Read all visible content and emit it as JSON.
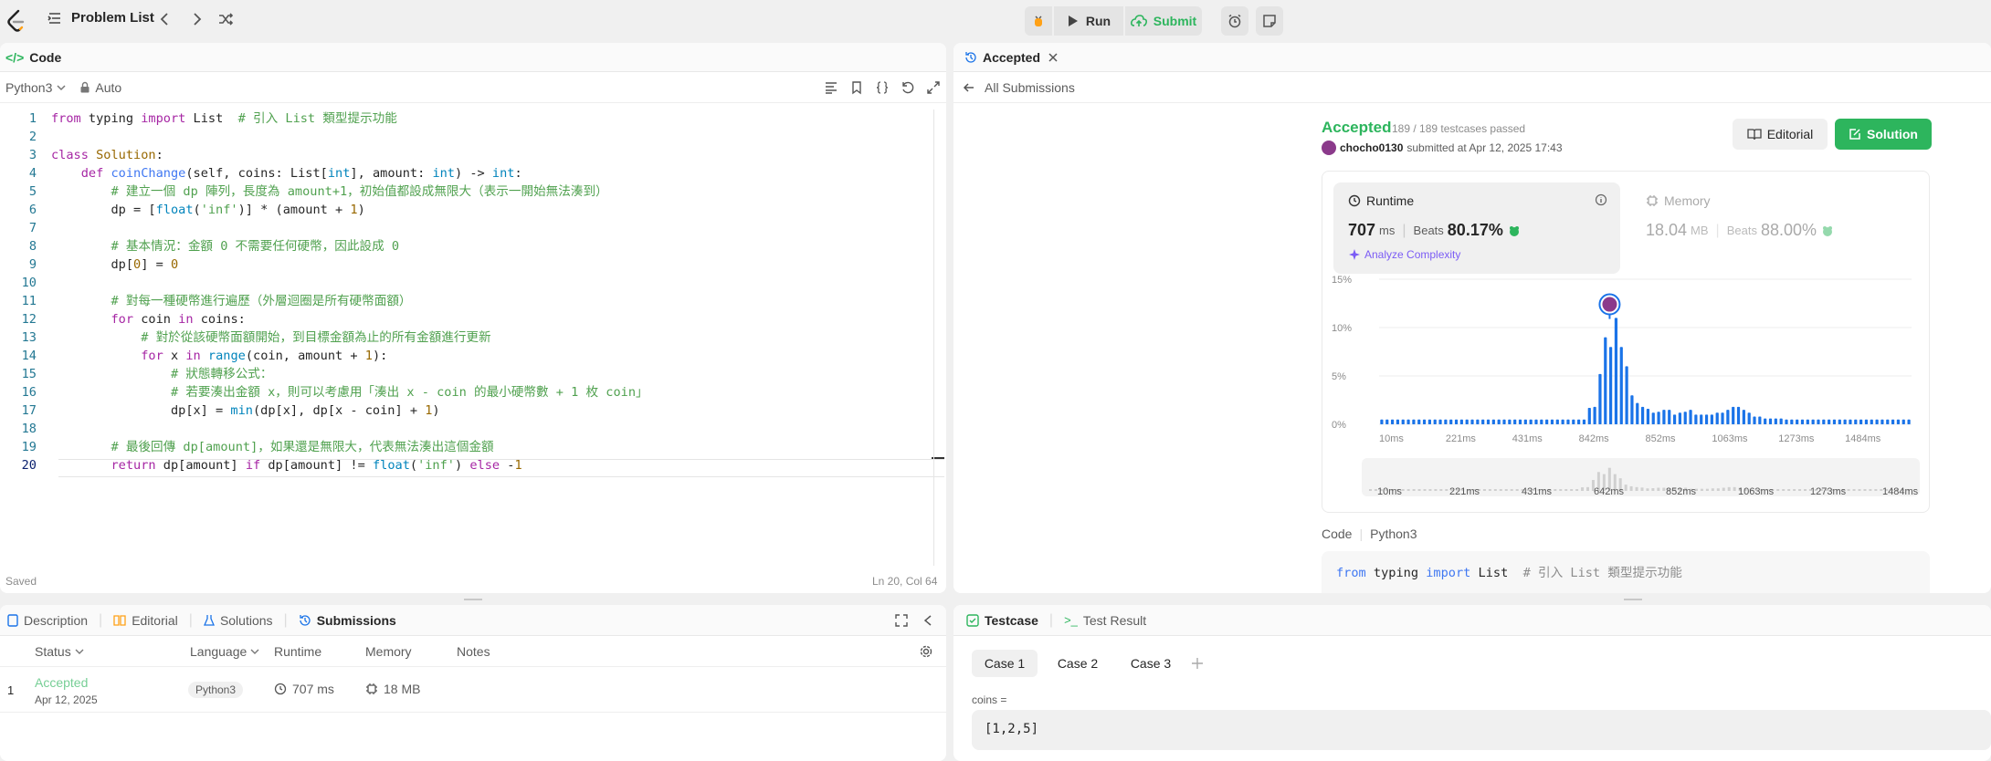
{
  "topbar": {
    "title": "Problem List",
    "run_label": "Run",
    "submit_label": "Submit"
  },
  "code_panel": {
    "title": "Code",
    "language": "Python3",
    "mode": "Auto",
    "status": "Saved",
    "position": "Ln 20, Col 64",
    "lines": [
      {
        "n": "1",
        "html": "<span class=\"kw\">from</span> typing <span class=\"kw\">import</span> List  <span class=\"cm\"># 引入 List 類型提示功能</span>"
      },
      {
        "n": "2",
        "html": ""
      },
      {
        "n": "3",
        "html": "<span class=\"kw\">class</span> <span class=\"nm\">Solution</span>:"
      },
      {
        "n": "4",
        "html": "    <span class=\"kw\">def</span> <span class=\"fn\">coinChange</span>(self, coins: List[<span class=\"bi\">int</span>], amount: <span class=\"bi\">int</span>) -> <span class=\"bi\">int</span>:"
      },
      {
        "n": "5",
        "html": "        <span class=\"cm\"># 建立一個 dp 陣列，長度為 amount+1，初始值都設成無限大（表示一開始無法湊到）</span>"
      },
      {
        "n": "6",
        "html": "        dp = [<span class=\"bi\">float</span>(<span class=\"st\">'inf'</span>)] * (amount + <span class=\"nm\">1</span>)"
      },
      {
        "n": "7",
        "html": ""
      },
      {
        "n": "8",
        "html": "        <span class=\"cm\"># 基本情況：金額 0 不需要任何硬幣，因此設成 0</span>"
      },
      {
        "n": "9",
        "html": "        dp[<span class=\"nm\">0</span>] = <span class=\"nm\">0</span>"
      },
      {
        "n": "10",
        "html": ""
      },
      {
        "n": "11",
        "html": "        <span class=\"cm\"># 對每一種硬幣進行遍歷（外層迴圈是所有硬幣面額）</span>"
      },
      {
        "n": "12",
        "html": "        <span class=\"kw\">for</span> coin <span class=\"kw\">in</span> coins:"
      },
      {
        "n": "13",
        "html": "            <span class=\"cm\"># 對於從該硬幣面額開始，到目標金額為止的所有金額進行更新</span>"
      },
      {
        "n": "14",
        "html": "            <span class=\"kw\">for</span> x <span class=\"kw\">in</span> <span class=\"bi\">range</span>(coin, amount + <span class=\"nm\">1</span>):"
      },
      {
        "n": "15",
        "html": "                <span class=\"cm\"># 狀態轉移公式：</span>"
      },
      {
        "n": "16",
        "html": "                <span class=\"cm\"># 若要湊出金額 x，則可以考慮用「湊出 x - coin 的最小硬幣數 + 1 枚 coin」</span>"
      },
      {
        "n": "17",
        "html": "                dp[x] = <span class=\"bi\">min</span>(dp[x], dp[x - coin] + <span class=\"nm\">1</span>)"
      },
      {
        "n": "18",
        "html": ""
      },
      {
        "n": "19",
        "html": "        <span class=\"cm\"># 最後回傳 dp[amount]，如果還是無限大，代表無法湊出這個金額</span>"
      },
      {
        "n": "20",
        "html": "        <span class=\"kw\">return</span> dp[amount] <span class=\"kw\">if</span> dp[amount] != <span class=\"bi\">float</span>(<span class=\"st\">'inf'</span>) <span class=\"kw\">else</span> -<span class=\"nm\">1</span>"
      }
    ]
  },
  "bottom_left": {
    "tabs": [
      "Description",
      "Editorial",
      "Solutions",
      "Submissions"
    ],
    "columns": [
      "Status",
      "Language",
      "Runtime",
      "Memory",
      "Notes"
    ],
    "rows": [
      {
        "index": "1",
        "status": "Accepted",
        "date": "Apr 12, 2025",
        "language": "Python3",
        "runtime": "707 ms",
        "memory": "18 MB"
      }
    ]
  },
  "accepted_panel": {
    "tab_label": "Accepted",
    "back_label": "All Submissions",
    "status": "Accepted",
    "testcases": "189 / 189 testcases passed",
    "user": "chocho0130",
    "submitted": "submitted at Apr 12, 2025 17:43",
    "editorial_label": "Editorial",
    "solution_label": "Solution",
    "runtime_label": "Runtime",
    "runtime_value": "707",
    "runtime_unit": "ms",
    "beats_label": "Beats",
    "runtime_beats": "80.17%",
    "analyze_label": "Analyze Complexity",
    "memory_label": "Memory",
    "memory_value": "18.04",
    "memory_unit": "MB",
    "memory_beats": "88.00%",
    "code_label": "Code",
    "code_lang": "Python3",
    "code_preview_html": "<span class=\"kw\" style=\"color:#4078f2\">from</span> typing <span style=\"color:#4078f2\">import</span> List  <span class=\"gray\"># 引入 List 類型提示功能</span>"
  },
  "chart_data": {
    "type": "bar",
    "yticks": [
      "15%",
      "10%",
      "5%",
      "0%"
    ],
    "ylim": [
      0,
      15
    ],
    "xticks": [
      "10ms",
      "221ms",
      "431ms",
      "842ms",
      "852ms",
      "1063ms",
      "1273ms",
      "1484ms"
    ],
    "mini_xticks": [
      "10ms",
      "221ms",
      "431ms",
      "642ms",
      "852ms",
      "1063ms",
      "1273ms",
      "1484ms"
    ],
    "values": [
      0.5,
      0.5,
      0.5,
      0.5,
      0.5,
      0.5,
      0.5,
      0.5,
      0.5,
      0.5,
      0.5,
      0.5,
      0.5,
      0.5,
      0.5,
      0.5,
      0.5,
      0.5,
      0.5,
      0.5,
      0.5,
      0.5,
      0.5,
      0.5,
      0.5,
      0.5,
      0.5,
      0.5,
      0.5,
      0.5,
      0.5,
      0.5,
      0.5,
      0.5,
      0.5,
      0.5,
      0.5,
      0.5,
      0.5,
      1.7,
      1.8,
      5.2,
      9.0,
      8.0,
      11.0,
      8.0,
      6.0,
      3.0,
      2.2,
      1.8,
      1.6,
      1.2,
      1.3,
      1.5,
      1.5,
      1.0,
      1.2,
      1.3,
      1.5,
      1.0,
      1.0,
      1.0,
      1.0,
      1.2,
      1.2,
      1.5,
      1.8,
      1.8,
      1.5,
      1.2,
      0.8,
      0.8,
      0.6,
      0.6,
      0.6,
      0.6,
      0.5,
      0.5,
      0.5,
      0.5,
      0.5,
      0.5,
      0.5,
      0.5,
      0.5,
      0.5,
      0.5,
      0.5,
      0.5,
      0.5,
      0.5,
      0.5,
      0.5,
      0.5,
      0.5,
      0.5,
      0.5,
      0.5,
      0.5,
      0.5
    ],
    "highlight_index": 44,
    "bar_color": "#1a73e8"
  },
  "bottom_right": {
    "tabs": [
      "Testcase",
      "Test Result"
    ],
    "cases": [
      "Case 1",
      "Case 2",
      "Case 3"
    ],
    "var_label": "coins =",
    "var_value": "[1,2,5]"
  }
}
